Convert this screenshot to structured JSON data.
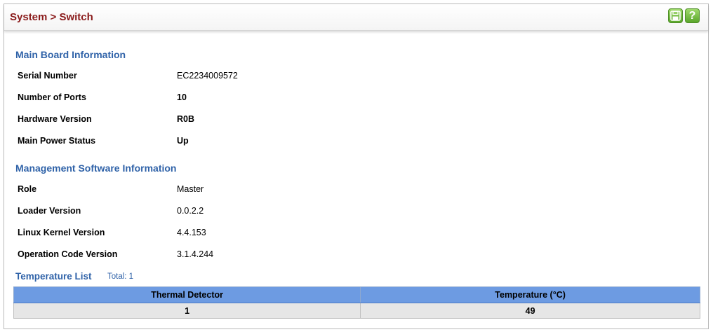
{
  "header": {
    "title": "System > Switch",
    "save_icon": "save-icon",
    "help_icon": "help-icon",
    "help_glyph": "?"
  },
  "main_board": {
    "heading": "Main Board Information",
    "rows": [
      {
        "label": "Serial Number",
        "value": "EC2234009572"
      },
      {
        "label": "Number of Ports",
        "value": "10"
      },
      {
        "label": "Hardware Version",
        "value": "R0B"
      },
      {
        "label": "Main Power Status",
        "value": "Up"
      }
    ]
  },
  "software": {
    "heading": "Management Software Information",
    "rows": [
      {
        "label": "Role",
        "value": "Master"
      },
      {
        "label": "Loader Version",
        "value": "0.0.2.2"
      },
      {
        "label": "Linux Kernel Version",
        "value": "4.4.153"
      },
      {
        "label": "Operation Code Version",
        "value": "3.1.4.244"
      }
    ]
  },
  "temperature": {
    "heading": "Temperature List",
    "total": "Total: 1",
    "columns": [
      "Thermal Detector",
      "Temperature (°C)"
    ],
    "rows": [
      [
        "1",
        "49"
      ]
    ]
  },
  "colors": {
    "title": "#8a1a1a",
    "section": "#2f62a8",
    "table_header": "#6d9be2",
    "button": "#5aa62b"
  }
}
